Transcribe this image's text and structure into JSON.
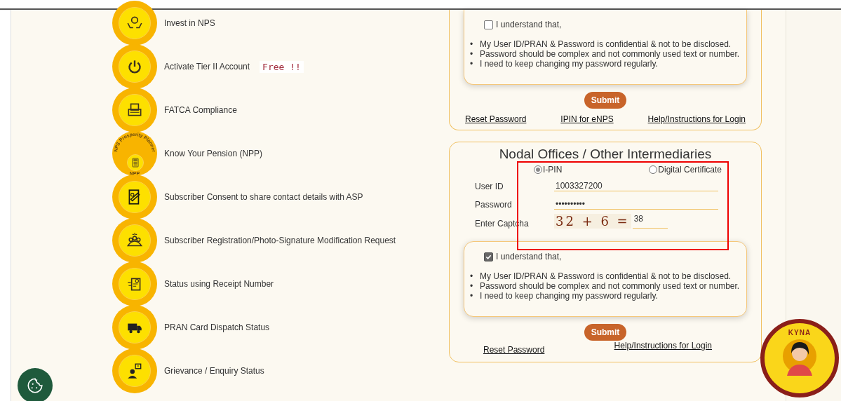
{
  "services": [
    {
      "label": "Invest in NPS"
    },
    {
      "label": "Activate Tier II Account",
      "badge": "Free !!"
    },
    {
      "label": "FATCA Compliance"
    },
    {
      "label": "Know Your Pension (NPP)",
      "ring_text": "NPS Prosperity Planner",
      "ring_caption": "NPP"
    },
    {
      "label": "Subscriber Consent to share contact details with ASP"
    },
    {
      "label": "Subscriber Registration/Photo-Signature Modification Request"
    },
    {
      "label": "Status using Receipt Number"
    },
    {
      "label": "PRAN Card Dispatch Status"
    },
    {
      "label": "Grievance / Enquiry Status"
    }
  ],
  "subscriber_login": {
    "declaration": {
      "checked": false,
      "label": "I understand that,",
      "marker": "•",
      "points": [
        "My User ID/PRAN & Password is confidential & not to be disclosed.",
        "Password should be complex and not commonly used text or number.",
        "I need to keep changing my password regularly."
      ]
    },
    "submit": "Submit",
    "links": [
      "Reset Password",
      "IPIN for eNPS",
      "Help/Instructions for Login"
    ]
  },
  "nodal_login": {
    "title": "Nodal Offices / Other Intermediaries",
    "modes": [
      {
        "label": "I-PIN",
        "selected": true
      },
      {
        "label": "Digital Certificate",
        "selected": false
      }
    ],
    "fields": [
      {
        "label": "User ID",
        "value": "1003327200"
      },
      {
        "label": "Password",
        "value": "••••••••••"
      }
    ],
    "captcha": {
      "label": "Enter Captcha",
      "challenge": "32 + 6 =",
      "value": "38"
    },
    "declaration": {
      "checked": true,
      "label": "I understand that,",
      "marker": "•",
      "points": [
        "My User ID/PRAN & Password is confidential & not to be disclosed.",
        "Password should be complex and not commonly used text or number.",
        "I need to keep changing my password regularly."
      ]
    },
    "submit": "Submit",
    "links": [
      "Reset Password",
      "Help/Instructions for Login"
    ]
  },
  "chatbot": {
    "label": "KYNA"
  }
}
